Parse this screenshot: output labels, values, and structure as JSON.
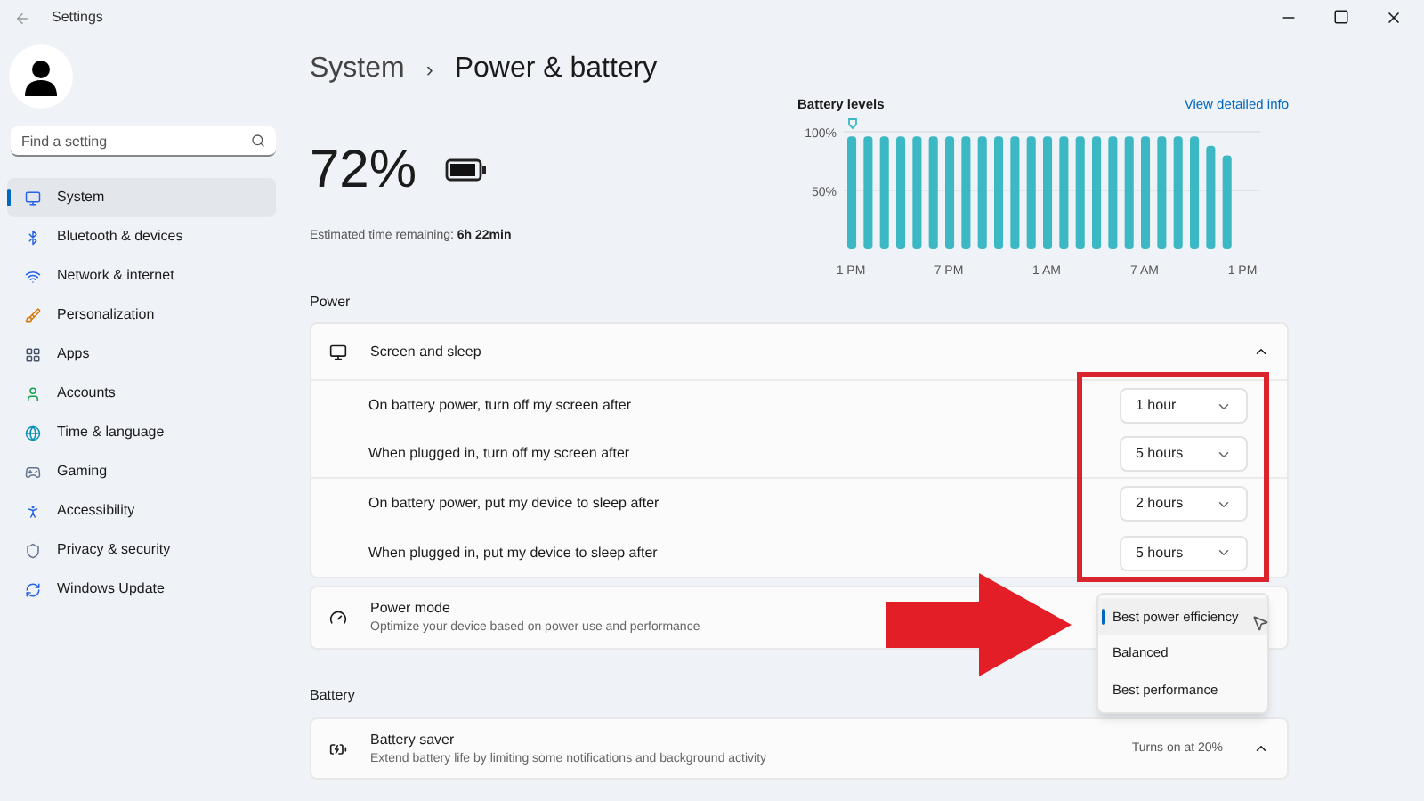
{
  "window": {
    "title": "Settings"
  },
  "sidebar": {
    "search": {
      "placeholder": "Find a setting"
    },
    "items": [
      {
        "label": "System",
        "selected": true
      },
      {
        "label": "Bluetooth & devices",
        "selected": false
      },
      {
        "label": "Network & internet",
        "selected": false
      },
      {
        "label": "Personalization",
        "selected": false
      },
      {
        "label": "Apps",
        "selected": false
      },
      {
        "label": "Accounts",
        "selected": false
      },
      {
        "label": "Time & language",
        "selected": false
      },
      {
        "label": "Gaming",
        "selected": false
      },
      {
        "label": "Accessibility",
        "selected": false
      },
      {
        "label": "Privacy & security",
        "selected": false
      },
      {
        "label": "Windows Update",
        "selected": false
      }
    ]
  },
  "breadcrumb": {
    "parent": "System",
    "separator": "›",
    "current": "Power & battery"
  },
  "battery": {
    "percent": "72%",
    "estimate_label": "Estimated time remaining:",
    "estimate_value": "6h 22min"
  },
  "battery_levels": {
    "link": "View detailed info",
    "chart_data": {
      "type": "bar",
      "title": "Battery levels",
      "categories": [
        "1 PM",
        null,
        null,
        null,
        null,
        null,
        "7 PM",
        null,
        null,
        null,
        null,
        null,
        "1 AM",
        null,
        null,
        null,
        null,
        null,
        "7 AM",
        null,
        null,
        null,
        null,
        null,
        "1 PM"
      ],
      "values": [
        96,
        96,
        96,
        96,
        96,
        96,
        96,
        96,
        96,
        96,
        96,
        96,
        96,
        96,
        96,
        96,
        96,
        96,
        96,
        96,
        96,
        96,
        88,
        80,
        null
      ],
      "ylim": [
        0,
        100
      ],
      "yticks": [
        {
          "value": 50,
          "label": "50%"
        },
        {
          "value": 100,
          "label": "100%"
        }
      ]
    }
  },
  "power": {
    "heading": "Power",
    "screen_sleep": {
      "title": "Screen and sleep",
      "expanded": true,
      "rows": [
        {
          "label": "On battery power, turn off my screen after",
          "value": "1 hour"
        },
        {
          "label": "When plugged in, turn off my screen after",
          "value": "5 hours"
        },
        {
          "label": "On battery power, put my device to sleep after",
          "value": "2 hours"
        },
        {
          "label": "When plugged in, put my device to sleep after",
          "value": "5 hours"
        }
      ]
    },
    "power_mode": {
      "title": "Power mode",
      "description": "Optimize your device based on power use and performance",
      "options": [
        {
          "label": "Best power efficiency",
          "selected": true
        },
        {
          "label": "Balanced",
          "selected": false
        },
        {
          "label": "Best performance",
          "selected": false
        }
      ]
    }
  },
  "battery_section": {
    "heading": "Battery",
    "saver": {
      "title": "Battery saver",
      "description": "Extend battery life by limiting some notifications and background activity",
      "status": "Turns on at 20%",
      "expanded": true
    }
  }
}
